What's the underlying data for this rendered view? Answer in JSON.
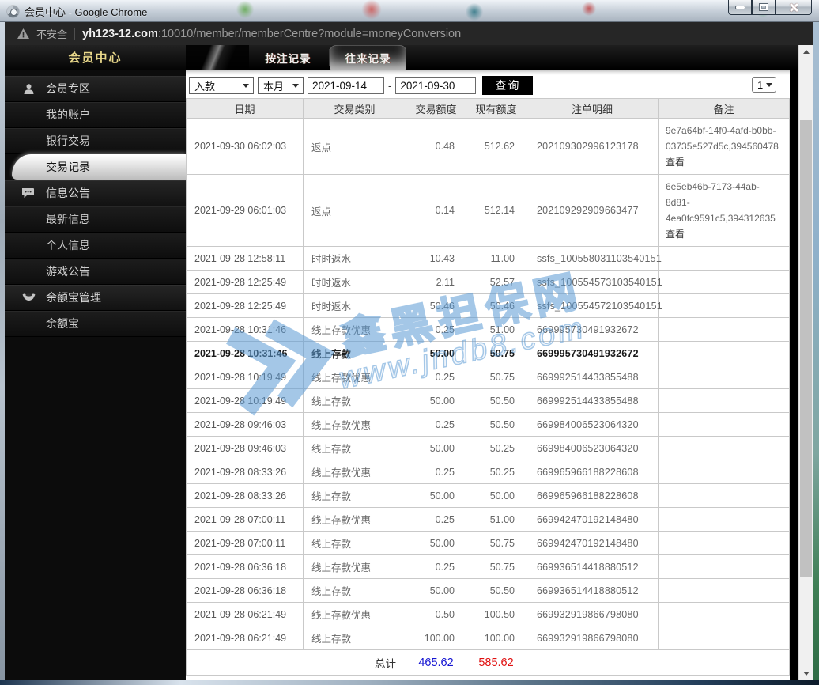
{
  "window": {
    "title": "会员中心 - Google Chrome"
  },
  "addressbar": {
    "security_label": "不安全",
    "host": "yh123-12.com",
    "path": ":10010/member/memberCentre?module=moneyConversion"
  },
  "sidebar": {
    "title": "会员中心",
    "items": [
      {
        "type": "header",
        "icon": "user-icon",
        "label": "会员专区"
      },
      {
        "type": "item",
        "label": "我的账户"
      },
      {
        "type": "item",
        "label": "银行交易"
      },
      {
        "type": "item",
        "label": "交易记录",
        "active": true
      },
      {
        "type": "header",
        "icon": "chat-icon",
        "label": "信息公告"
      },
      {
        "type": "item",
        "label": "最新信息"
      },
      {
        "type": "item",
        "label": "个人信息"
      },
      {
        "type": "item",
        "label": "游戏公告"
      },
      {
        "type": "header",
        "icon": "ingot-icon",
        "label": "余额宝管理"
      },
      {
        "type": "item",
        "label": "余额宝"
      }
    ]
  },
  "tabs": [
    {
      "label": "按注记录",
      "active": false
    },
    {
      "label": "往来记录",
      "active": true
    }
  ],
  "filters": {
    "type_select": "入款",
    "period_select": "本月",
    "date_from": "2021-09-14",
    "date_separator": "-",
    "date_to": "2021-09-30",
    "search_button": "查询",
    "page_select": "1"
  },
  "table": {
    "headers": [
      "日期",
      "交易类别",
      "交易额度",
      "现有额度",
      "注单明细",
      "备注"
    ],
    "rows": [
      {
        "date": "2021-09-30 06:02:03",
        "type": "返点",
        "amount": "0.48",
        "balance": "512.62",
        "order": "202109302996123178",
        "remark": "9e7a64bf-14f0-4afd-b0bb-03735e527d5c,394560478",
        "remark_link": "查看"
      },
      {
        "date": "2021-09-29 06:01:03",
        "type": "返点",
        "amount": "0.14",
        "balance": "512.14",
        "order": "202109292909663477",
        "remark": "6e5eb46b-7173-44ab-8d81-4ea0fc9591c5,394312635",
        "remark_link": "查看"
      },
      {
        "date": "2021-09-28 12:58:11",
        "type": "时时返水",
        "amount": "10.43",
        "balance": "11.00",
        "order": "ssfs_100558031103540151"
      },
      {
        "date": "2021-09-28 12:25:49",
        "type": "时时返水",
        "amount": "2.11",
        "balance": "52.57",
        "order": "ssfs_100554573103540151"
      },
      {
        "date": "2021-09-28 12:25:49",
        "type": "时时返水",
        "amount": "50.46",
        "balance": "50.46",
        "order": "ssfs_100554572103540151"
      },
      {
        "date": "2021-09-28 10:31:46",
        "type": "线上存款优惠",
        "amount": "0.25",
        "balance": "51.00",
        "order": "669995730491932672"
      },
      {
        "date": "2021-09-28 10:31:46",
        "type": "线上存款",
        "amount": "50.00",
        "balance": "50.75",
        "order": "669995730491932672",
        "bold": true
      },
      {
        "date": "2021-09-28 10:19:49",
        "type": "线上存款优惠",
        "amount": "0.25",
        "balance": "50.75",
        "order": "669992514433855488"
      },
      {
        "date": "2021-09-28 10:19:49",
        "type": "线上存款",
        "amount": "50.00",
        "balance": "50.50",
        "order": "669992514433855488"
      },
      {
        "date": "2021-09-28 09:46:03",
        "type": "线上存款优惠",
        "amount": "0.25",
        "balance": "50.50",
        "order": "669984006523064320"
      },
      {
        "date": "2021-09-28 09:46:03",
        "type": "线上存款",
        "amount": "50.00",
        "balance": "50.25",
        "order": "669984006523064320"
      },
      {
        "date": "2021-09-28 08:33:26",
        "type": "线上存款优惠",
        "amount": "0.25",
        "balance": "50.25",
        "order": "669965966188228608"
      },
      {
        "date": "2021-09-28 08:33:26",
        "type": "线上存款",
        "amount": "50.00",
        "balance": "50.00",
        "order": "669965966188228608"
      },
      {
        "date": "2021-09-28 07:00:11",
        "type": "线上存款优惠",
        "amount": "0.25",
        "balance": "51.00",
        "order": "669942470192148480"
      },
      {
        "date": "2021-09-28 07:00:11",
        "type": "线上存款",
        "amount": "50.00",
        "balance": "50.75",
        "order": "669942470192148480"
      },
      {
        "date": "2021-09-28 06:36:18",
        "type": "线上存款优惠",
        "amount": "0.25",
        "balance": "50.75",
        "order": "669936514418880512"
      },
      {
        "date": "2021-09-28 06:36:18",
        "type": "线上存款",
        "amount": "50.00",
        "balance": "50.50",
        "order": "669936514418880512"
      },
      {
        "date": "2021-09-28 06:21:49",
        "type": "线上存款优惠",
        "amount": "0.50",
        "balance": "100.50",
        "order": "669932919866798080"
      },
      {
        "date": "2021-09-28 06:21:49",
        "type": "线上存款",
        "amount": "100.00",
        "balance": "100.00",
        "order": "669932919866798080"
      }
    ],
    "footer": {
      "label": "总计",
      "total_amount": "465.62",
      "total_balance": "585.62"
    }
  },
  "watermark": {
    "line1": "鑫黑担保网",
    "line2": "www.jndb8.com"
  },
  "colors": {
    "total_amount_blue": "#1414d2",
    "total_balance_red": "#e01010",
    "watermark_blue": "#5b9bd5",
    "sidebar_title_gold": "#ead98b",
    "close_button_red": "#b52a14"
  }
}
